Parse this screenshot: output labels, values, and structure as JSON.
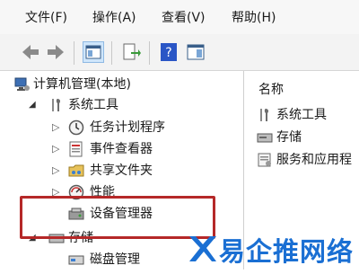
{
  "menubar": {
    "file": "文件(F)",
    "action": "操作(A)",
    "view": "查看(V)",
    "help": "帮助(H)"
  },
  "tree": {
    "root": "计算机管理(本地)",
    "system_tools": "系统工具",
    "task_scheduler": "任务计划程序",
    "event_viewer": "事件查看器",
    "shared_folders": "共享文件夹",
    "performance": "性能",
    "device_manager": "设备管理器",
    "storage": "存储",
    "disk_management": "磁盘管理"
  },
  "right": {
    "column_name": "名称",
    "items": [
      "系统工具",
      "存储",
      "服务和应用程"
    ]
  },
  "watermark": {
    "text": "易企推网络"
  },
  "colors": {
    "highlight_box": "#b52828",
    "watermark": "#1a6fd3"
  }
}
